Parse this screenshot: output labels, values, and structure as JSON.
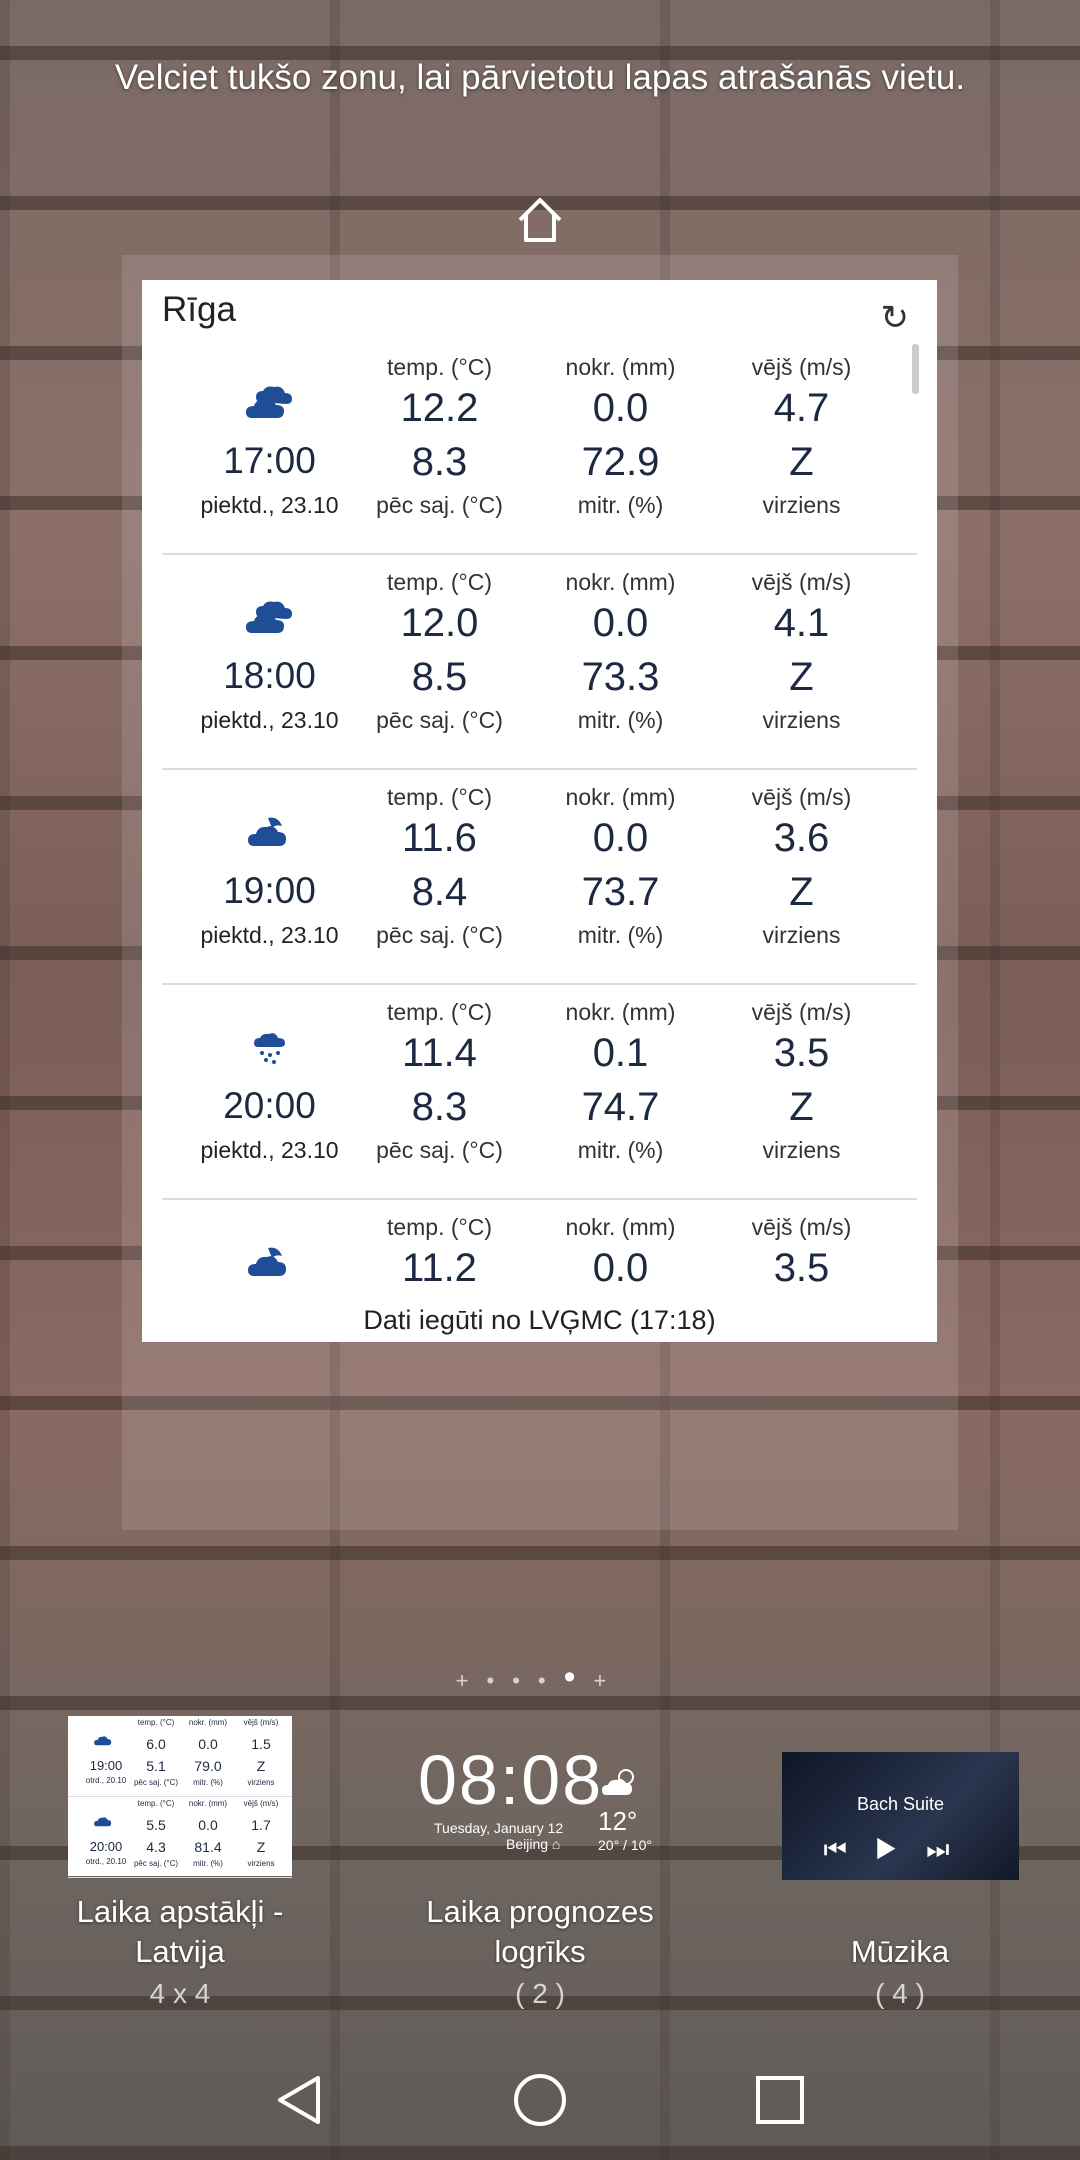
{
  "hint": "Velciet tukšo zonu, lai pārvietotu lapas atrašanās vietu.",
  "widget": {
    "city": "Rīga",
    "refresh_icon": "↻",
    "labels": {
      "temp": "temp. (°C)",
      "precip": "nokr. (mm)",
      "wind": "vējš (m/s)",
      "feels": "pēc saj. (°C)",
      "humidity": "mitr. (%)",
      "direction": "virziens"
    },
    "rows": [
      {
        "time": "17:00",
        "date": "piektd., 23.10",
        "temp": "12.2",
        "feels": "8.3",
        "precip": "0.0",
        "humidity": "72.9",
        "wind": "4.7",
        "dir": "Z",
        "icon": "cloudy-icon"
      },
      {
        "time": "18:00",
        "date": "piektd., 23.10",
        "temp": "12.0",
        "feels": "8.5",
        "precip": "0.0",
        "humidity": "73.3",
        "wind": "4.1",
        "dir": "Z",
        "icon": "cloudy-icon"
      },
      {
        "time": "19:00",
        "date": "piektd., 23.10",
        "temp": "11.6",
        "feels": "8.4",
        "precip": "0.0",
        "humidity": "73.7",
        "wind": "3.6",
        "dir": "Z",
        "icon": "partly-cloudy-night-icon"
      },
      {
        "time": "20:00",
        "date": "piektd., 23.10",
        "temp": "11.4",
        "feels": "8.3",
        "precip": "0.1",
        "humidity": "74.7",
        "wind": "3.5",
        "dir": "Z",
        "icon": "rain-icon"
      },
      {
        "time": "",
        "date": "",
        "temp": "11.2",
        "feels": "",
        "precip": "0.0",
        "humidity": "",
        "wind": "3.5",
        "dir": "",
        "icon": "partly-cloudy-night-icon"
      }
    ],
    "footer": "Dati iegūti no LVĢMC (17:18)"
  },
  "dock": {
    "latvia": {
      "label": "Laika apstākļi -\nLatvija",
      "sub": "4 x 4",
      "preview": [
        {
          "time": "19:00",
          "date": "otrd., 20.10",
          "temp": "6.0",
          "feels": "5.1",
          "precip": "0.0",
          "humidity": "79.0",
          "wind": "1.5",
          "dir": "Z"
        },
        {
          "time": "20:00",
          "date": "otrd., 20.10",
          "temp": "5.5",
          "feels": "4.3",
          "precip": "0.0",
          "humidity": "81.4",
          "wind": "1.7",
          "dir": "Z"
        }
      ],
      "labels": {
        "temp": "temp. (°C)",
        "precip": "nokr. (mm)",
        "wind": "vējš (m/s)",
        "feels": "pēc saj. (°C)",
        "humidity": "mitr. (%)",
        "direction": "virziens"
      }
    },
    "forecast": {
      "label": "Laika prognozes\nlogrīks",
      "sub": "( 2 )",
      "clock": "08:08",
      "date": "Tuesday, January 12",
      "location": "Beijing",
      "temp": "12°",
      "range": "20° / 10°"
    },
    "music": {
      "label": "Mūzika",
      "sub": "( 4 )",
      "track": "Bach Suite"
    }
  }
}
